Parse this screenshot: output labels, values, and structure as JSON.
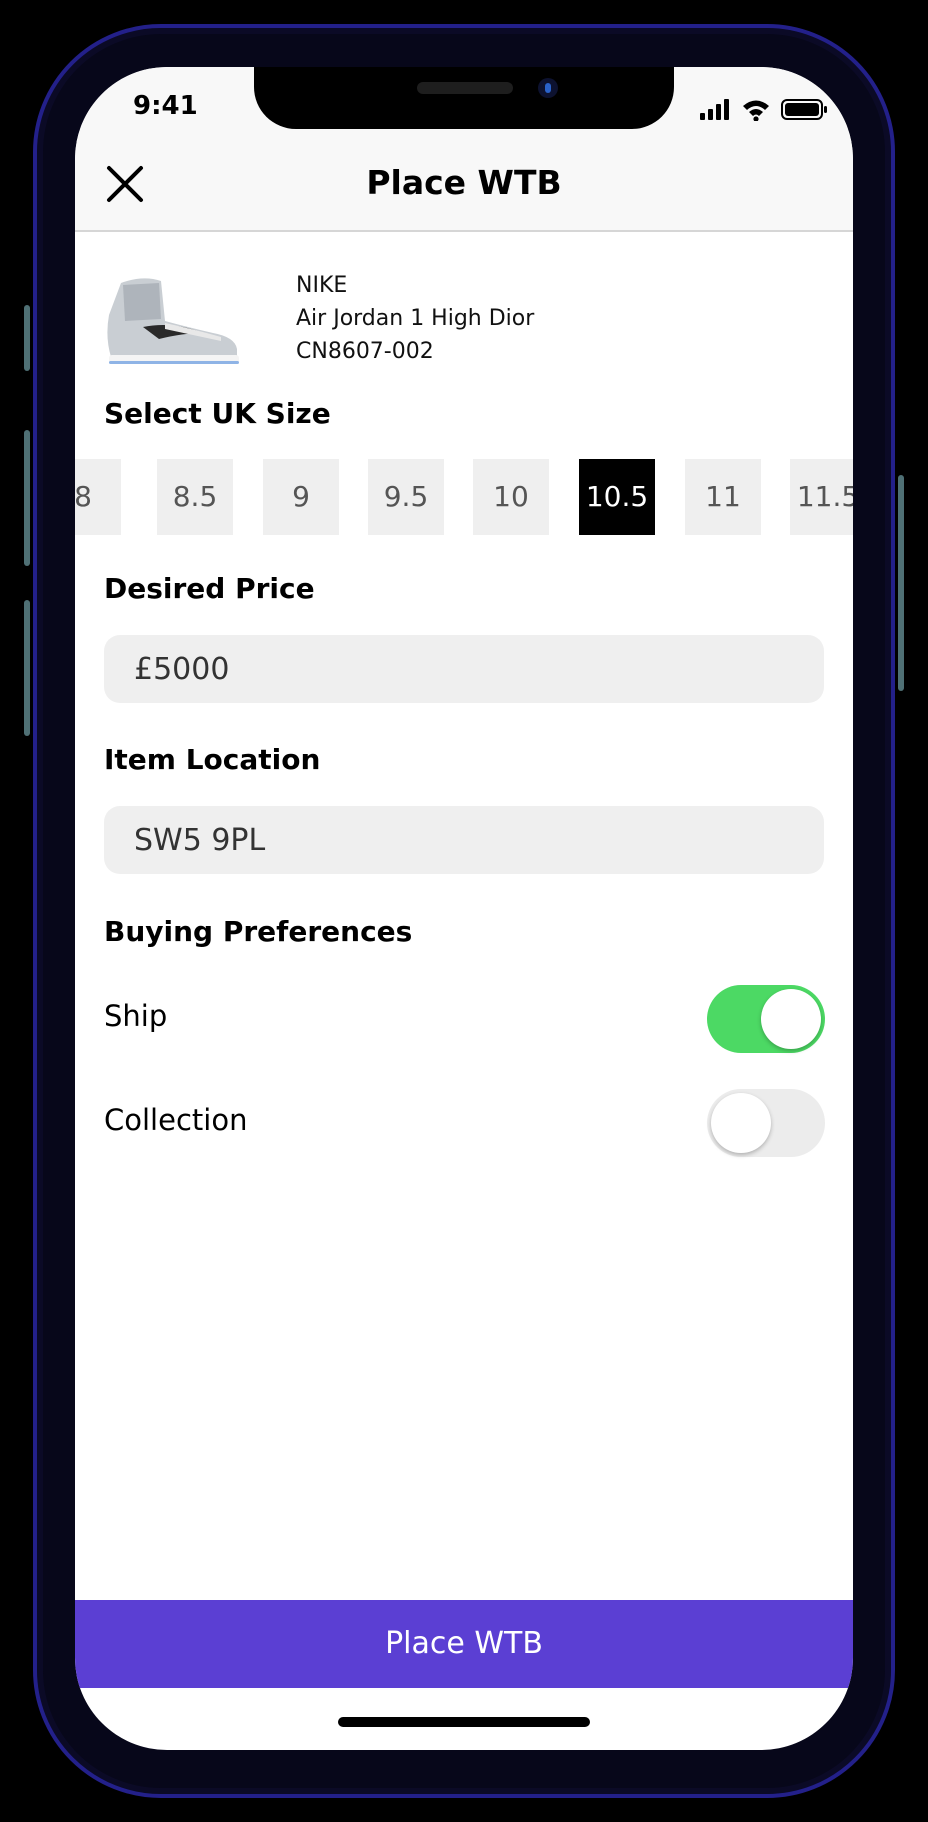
{
  "status_bar": {
    "time": "9:41"
  },
  "header": {
    "title": "Place WTB",
    "close_icon": "close-icon"
  },
  "product": {
    "brand": "NIKE",
    "name": "Air Jordan 1 High Dior",
    "sku": "CN8607-002"
  },
  "size_section": {
    "label": "Select UK Size",
    "sizes": [
      "8",
      "8.5",
      "9",
      "9.5",
      "10",
      "10.5",
      "11",
      "11.5"
    ],
    "selected": "10.5"
  },
  "price": {
    "label": "Desired Price",
    "value": "£5000"
  },
  "location": {
    "label": "Item Location",
    "value": "SW5 9PL"
  },
  "preferences": {
    "label": "Buying Preferences",
    "items": [
      {
        "label": "Ship",
        "enabled": true
      },
      {
        "label": "Collection",
        "enabled": false
      }
    ]
  },
  "cta": {
    "label": "Place WTB"
  },
  "colors": {
    "accent": "#5b3fd3",
    "toggle_on": "#4cd964",
    "selected_size": "#000000"
  }
}
